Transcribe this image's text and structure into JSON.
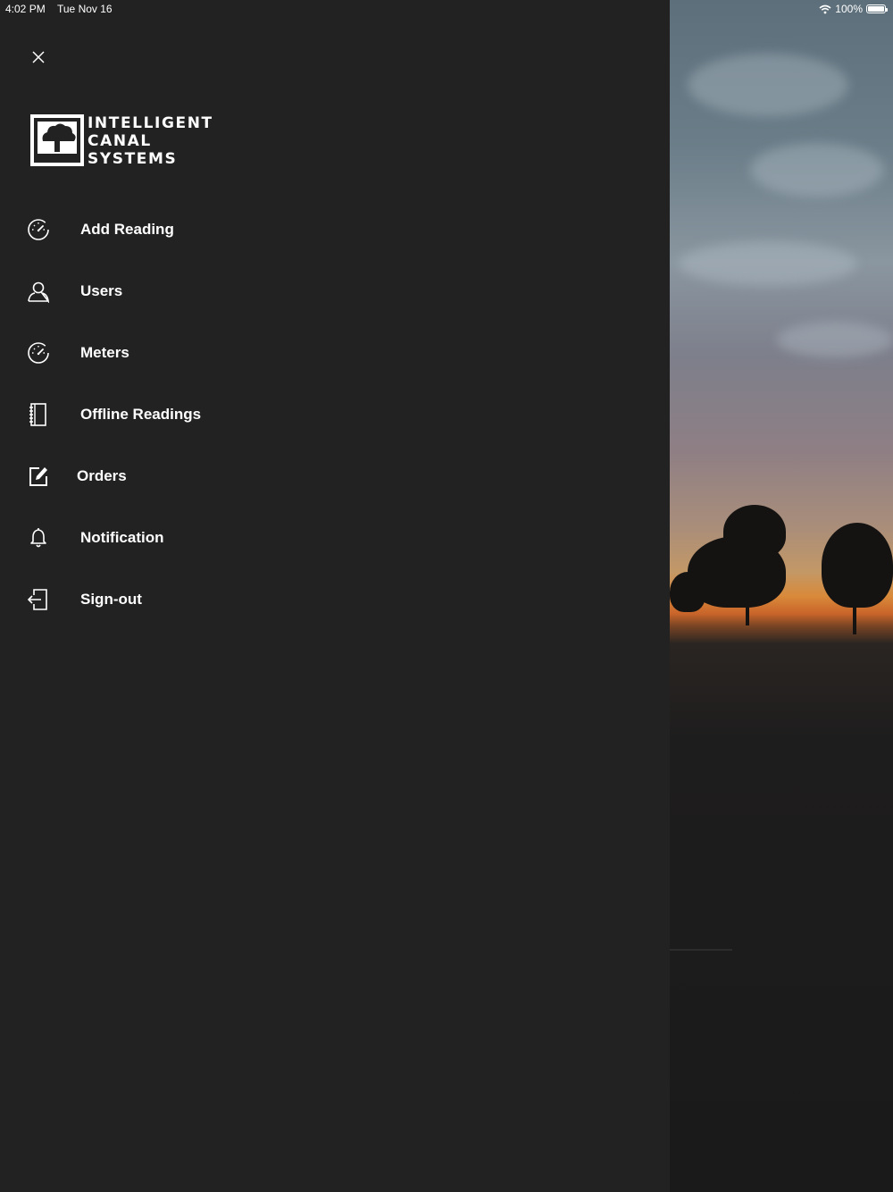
{
  "status_bar": {
    "time": "4:02 PM",
    "date": "Tue Nov 16",
    "battery_text": "100%",
    "icons": [
      "wifi-icon",
      "battery-icon"
    ]
  },
  "drawer": {
    "close_icon": "close-icon",
    "logo": {
      "line1": "INTELLIGENT",
      "line2": "CANAL",
      "line3": "SYSTEMS"
    },
    "menu": [
      {
        "label": "Add Reading",
        "icon": "speedometer-icon"
      },
      {
        "label": "Users",
        "icon": "user-icon"
      },
      {
        "label": "Meters",
        "icon": "speedometer-icon"
      },
      {
        "label": "Offline Readings",
        "icon": "notebook-icon"
      },
      {
        "label": "Orders",
        "icon": "edit-icon"
      },
      {
        "label": "Notification",
        "icon": "bell-icon"
      },
      {
        "label": "Sign-out",
        "icon": "sign-out-icon"
      }
    ]
  },
  "colors": {
    "drawer_bg": "#222223",
    "text": "#ffffff"
  }
}
